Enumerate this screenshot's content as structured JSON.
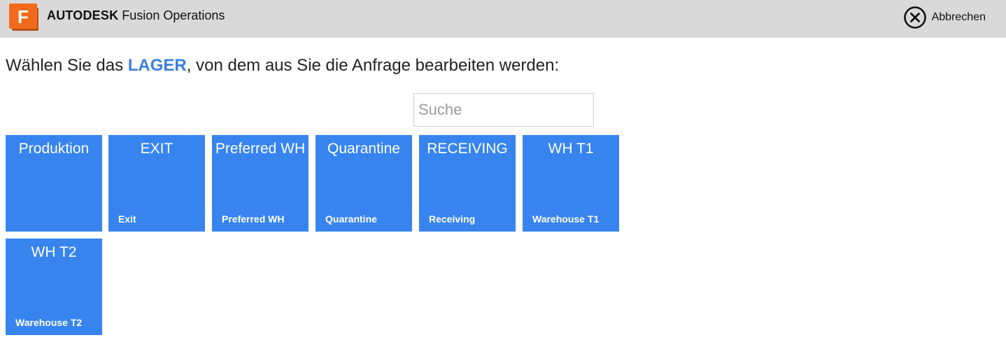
{
  "header": {
    "brand_bold": "AUTODESK",
    "brand_rest": "Fusion Operations",
    "logo_letter": "F",
    "cancel_label": "Abbrechen"
  },
  "prompt": {
    "before": "Wählen Sie das ",
    "highlight": "LAGER",
    "after": ", von dem aus Sie die Anfrage bearbeiten werden:"
  },
  "search": {
    "placeholder": "Suche",
    "value": ""
  },
  "tiles": [
    {
      "title": "Produktion",
      "subtitle": ""
    },
    {
      "title": "EXIT",
      "subtitle": "Exit"
    },
    {
      "title": "Preferred WH",
      "subtitle": "Preferred WH"
    },
    {
      "title": "Quarantine",
      "subtitle": "Quarantine"
    },
    {
      "title": "RECEIVING",
      "subtitle": "Receiving"
    },
    {
      "title": "WH T1",
      "subtitle": "Warehouse T1"
    },
    {
      "title": "WH T2",
      "subtitle": "Warehouse T2"
    }
  ],
  "colors": {
    "tile": "#3784ef",
    "highlight": "#3b7fe0",
    "header_bg": "#d9d9d9",
    "logo_orange": "#f26a1b"
  }
}
